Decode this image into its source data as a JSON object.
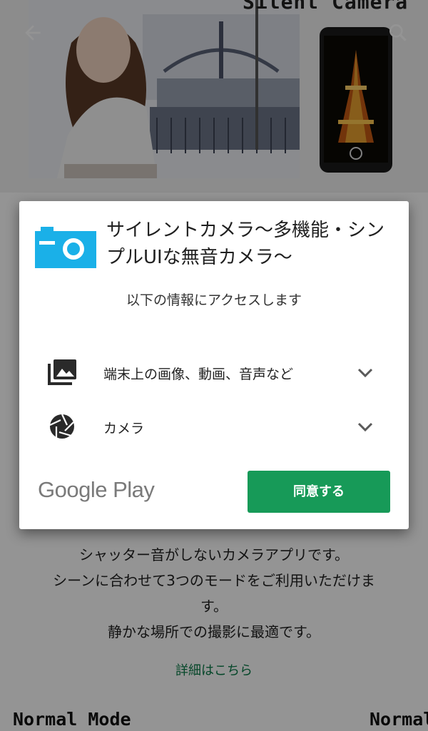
{
  "hero": {
    "title": "Silent Camera"
  },
  "dialog": {
    "app_title": "サイレントカメラ〜多機能・シンプルUIな無音カメラ〜",
    "access_text": "以下の情報にアクセスします",
    "permissions": [
      {
        "label": "端末上の画像、動画、音声など",
        "icon": "photo-library-icon"
      },
      {
        "label": "カメラ",
        "icon": "camera-shutter-icon"
      }
    ],
    "store_logo": "Google Play",
    "agree_label": "同意する",
    "accent_color": "#179a58",
    "icon_color": "#1ab0e8"
  },
  "description": {
    "lines": [
      "シャッター音がしないカメラアプリです。",
      "シーンに合わせて3つのモードをご利用いただけま",
      "す。",
      "静かな場所での撮影に最適です。"
    ],
    "more_link": "詳細はこちら"
  },
  "modes": {
    "left": "Normal Mode",
    "right": "Normal"
  }
}
